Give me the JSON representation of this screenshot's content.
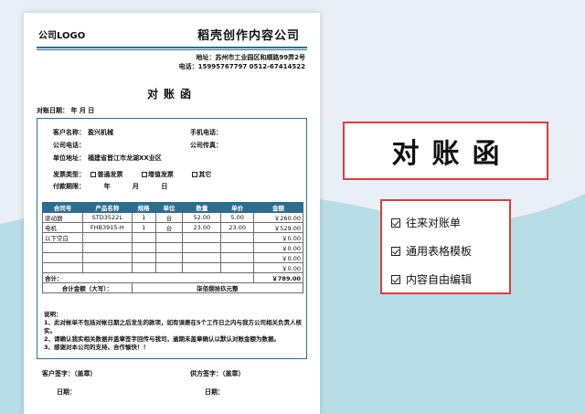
{
  "doc": {
    "logo": "公司LOGO",
    "company": "稻壳创作内容公司",
    "address": "地址：苏州市工业园区和顺路99弄2号",
    "phone": "电话：15995767797 0512-67414522",
    "title": "对账函",
    "date_line": "对账日期： 年 月 日"
  },
  "info": {
    "customer_label": "客户名称：",
    "customer_value": "盈兴机械",
    "mobile_label": "手机电话：",
    "tel_label": "公司电话：",
    "fax_label": "公司传真：",
    "unit_addr_label": "单位地址：",
    "unit_addr_value": "福建省晋江市龙湖XX业区",
    "invoice_label": "发票类型：",
    "invoice_opt1": "普通发票",
    "invoice_opt2": "增值发票",
    "invoice_opt3": "其它",
    "pay_label": "付款期限：",
    "pay_year": "年",
    "pay_month": "月",
    "pay_day": "日"
  },
  "table": {
    "headers": [
      "合同号",
      "产品名称",
      "规格",
      "单位",
      "数量",
      "单价",
      "金额"
    ],
    "rows": [
      [
        "驱动器",
        "STD3522L",
        "1",
        "台",
        "52.00",
        "5.00",
        "￥260.00"
      ],
      [
        "电机",
        "FHB3915-H",
        "1",
        "台",
        "23.00",
        "23.00",
        "￥529.00"
      ],
      [
        "以下空白",
        "",
        "",
        "",
        "",
        "",
        "￥0.00"
      ],
      [
        "",
        "",
        "",
        "",
        "",
        "",
        "￥0.00"
      ],
      [
        "",
        "",
        "",
        "",
        "",
        "",
        "￥0.00"
      ],
      [
        "",
        "",
        "",
        "",
        "",
        "",
        "￥0.00"
      ]
    ],
    "total_label": "合计：",
    "total_value": "￥789.00",
    "upper_label": "合计金额（大写）：",
    "upper_value": "柒佰捌拾玖元整"
  },
  "notes": {
    "heading": "说明：",
    "n1": "1、此对帐单不包括对帐日期之后发生的款项，如有误差在5个工作日之内与我方公司相关负责人核实。",
    "n2": "2、请确认我实相关数据并盖章签字回传与我司，逾期未盖章确认以默认对账金额为数据。",
    "n3": "3、感谢对本公司的支持，合作愉快！！"
  },
  "sign": {
    "customer": "客户签字：（盖章）",
    "supplier": "供方签字：（盖章）",
    "date1": "日期：",
    "date2": "日期："
  },
  "side": {
    "title": "对账函",
    "features": [
      "往来对账单",
      "通用表格模板",
      "内容自由编辑"
    ]
  },
  "colors": {
    "accent": "#2e6c8e",
    "highlight_border": "#e03c3c",
    "wave": "#b9dde6"
  }
}
